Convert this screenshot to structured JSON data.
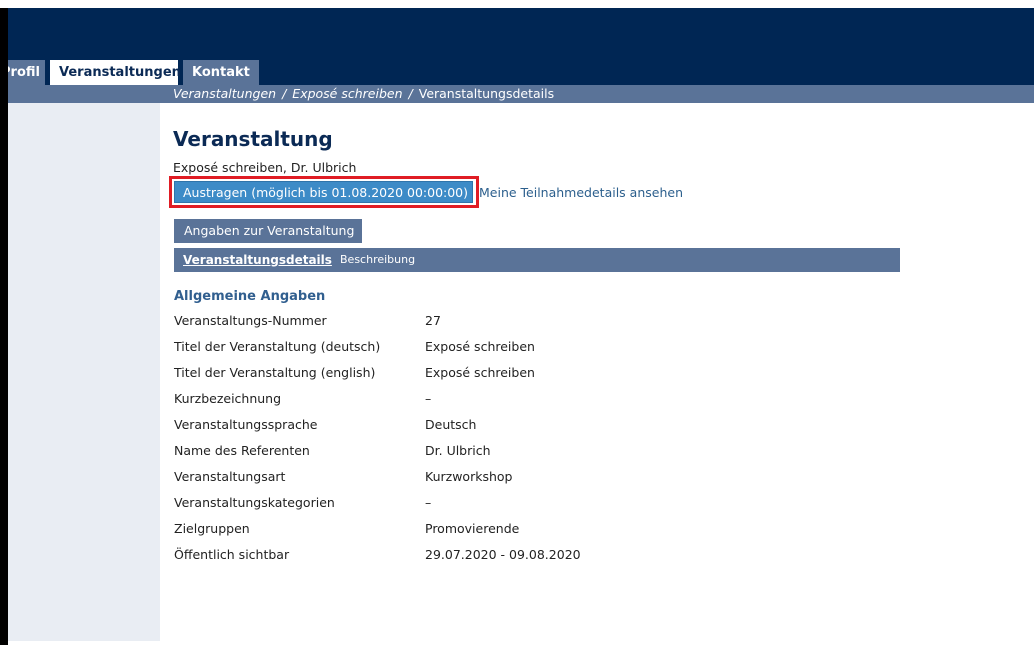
{
  "nav": {
    "tabs": [
      {
        "label": "Profil"
      },
      {
        "label": "Veranstaltungen"
      },
      {
        "label": "Kontakt"
      }
    ]
  },
  "breadcrumb": {
    "items": [
      "Veranstaltungen",
      "Exposé schreiben",
      "Veranstaltungsdetails"
    ],
    "separator": "/"
  },
  "page": {
    "title": "Veranstaltung",
    "subtitle": "Exposé schreiben, Dr. Ulbrich"
  },
  "actions": {
    "austragen_label": "Austragen (möglich bis 01.08.2020 00:00:00)",
    "teilnahme_link": "Meine Teilnahmedetails ansehen",
    "angaben_label": "Angaben zur Veranstaltung"
  },
  "subtabs": [
    {
      "label": "Veranstaltungsdetails",
      "active": true
    },
    {
      "label": "Beschreibung",
      "active": false
    }
  ],
  "section": {
    "title": "Allgemeine Angaben",
    "rows": [
      {
        "label": "Veranstaltungs-Nummer",
        "value": "27"
      },
      {
        "label": "Titel der Veranstaltung (deutsch)",
        "value": "Exposé schreiben"
      },
      {
        "label": "Titel der Veranstaltung (english)",
        "value": "Exposé schreiben"
      },
      {
        "label": "Kurzbezeichnung",
        "value": "–"
      },
      {
        "label": "Veranstaltungssprache",
        "value": "Deutsch"
      },
      {
        "label": "Name des Referenten",
        "value": "Dr. Ulbrich"
      },
      {
        "label": "Veranstaltungsart",
        "value": "Kurzworkshop"
      },
      {
        "label": "Veranstaltungskategorien",
        "value": "–"
      },
      {
        "label": "Zielgruppen",
        "value": "Promovierende"
      },
      {
        "label": "Öffentlich sichtbar",
        "value": "29.07.2020 - 09.08.2020"
      }
    ]
  },
  "colors": {
    "header": "#002654",
    "nav_bar": "#5a7398",
    "sidebar": "#e9edf3",
    "accent_button": "#3d8bc7",
    "highlight": "#e01c24",
    "title": "#0b2a55"
  }
}
